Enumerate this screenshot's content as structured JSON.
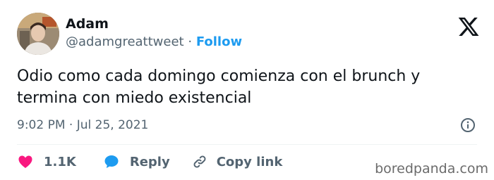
{
  "tweet": {
    "display_name": "Adam",
    "handle": "@adamgreattweet",
    "separator": "·",
    "follow_label": "Follow",
    "text": "Odio como cada domingo comienza con el brunch y termina con miedo existencial",
    "timestamp": "9:02 PM · Jul 25, 2021"
  },
  "actions": {
    "like_count": "1.1K",
    "reply_label": "Reply",
    "copy_label": "Copy link"
  },
  "watermark": "boredpanda.com",
  "icons": {
    "platform": "x-logo-icon",
    "info": "info-icon",
    "like": "heart-icon",
    "reply": "speech-bubble-icon",
    "copy": "link-icon"
  },
  "colors": {
    "accent": "#1d9bf0",
    "like": "#f91880",
    "secondary_text": "#536471"
  }
}
